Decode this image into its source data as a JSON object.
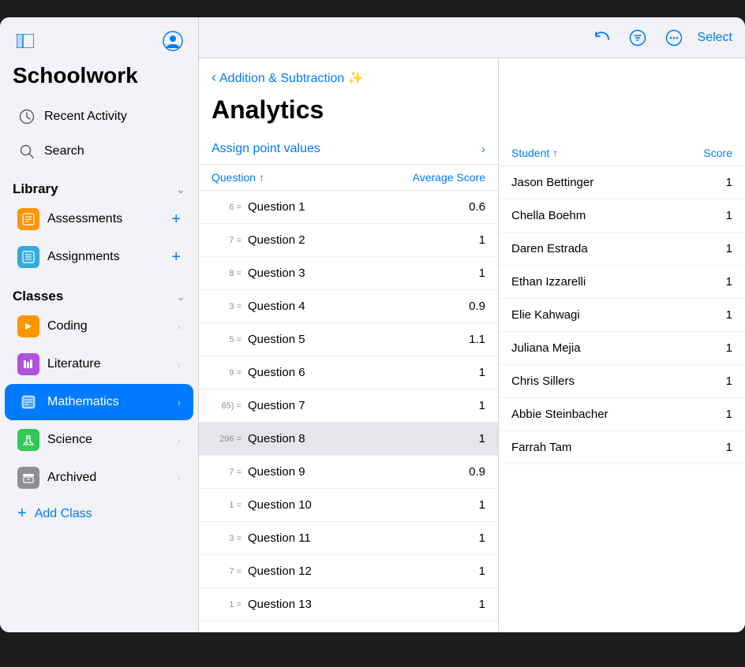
{
  "app": {
    "title": "Schoolwork"
  },
  "sidebar": {
    "recent_activity": "Recent Activity",
    "search": "Search",
    "library_section": "Library",
    "library_items": [
      {
        "id": "assessments",
        "label": "Assessments",
        "icon": "⊞",
        "type": "assessments"
      },
      {
        "id": "assignments",
        "label": "Assignments",
        "icon": "☰",
        "type": "assignments"
      }
    ],
    "classes_section": "Classes",
    "classes": [
      {
        "id": "coding",
        "label": "Coding",
        "icon": "🔶",
        "type": "coding",
        "selected": false
      },
      {
        "id": "literature",
        "label": "Literature",
        "icon": "📊",
        "type": "literature",
        "selected": false
      },
      {
        "id": "mathematics",
        "label": "Mathematics",
        "icon": "🗒️",
        "type": "mathematics",
        "selected": true
      },
      {
        "id": "science",
        "label": "Science",
        "icon": "✳️",
        "type": "science",
        "selected": false
      },
      {
        "id": "archived",
        "label": "Archived",
        "icon": "🗄️",
        "type": "archived",
        "selected": false
      }
    ],
    "add_class": "Add Class"
  },
  "nav": {
    "back_label": "Addition & Subtraction ✨"
  },
  "analytics": {
    "title": "Analytics",
    "assign_point_values": "Assign point values",
    "questions_header": "Question",
    "avg_score_header": "Average Score",
    "questions": [
      {
        "prefix": "6 =",
        "name": "Question 1",
        "score": "0.6"
      },
      {
        "prefix": "7 =",
        "name": "Question 2",
        "score": "1"
      },
      {
        "prefix": "8 =",
        "name": "Question 3",
        "score": "1"
      },
      {
        "prefix": "3 =",
        "name": "Question 4",
        "score": "0.9"
      },
      {
        "prefix": "5 =",
        "name": "Question 5",
        "score": "1.1"
      },
      {
        "prefix": "9 =",
        "name": "Question 6",
        "score": "1"
      },
      {
        "prefix": "",
        "name": "Question 7",
        "score": "1"
      },
      {
        "prefix": "296 =",
        "name": "Question 8",
        "score": "1",
        "selected": true
      },
      {
        "prefix": "7 =",
        "name": "Question 9",
        "score": "0.9"
      },
      {
        "prefix": "1 =",
        "name": "Question 10",
        "score": "1"
      },
      {
        "prefix": "3 =",
        "name": "Question 11",
        "score": "1"
      },
      {
        "prefix": "7 =",
        "name": "Question 12",
        "score": "1"
      },
      {
        "prefix": "1 =",
        "name": "Question 13",
        "score": "1"
      }
    ]
  },
  "students": {
    "header": "Student",
    "score_header": "Score",
    "list": [
      {
        "name": "Jason Bettinger",
        "score": "1"
      },
      {
        "name": "Chella Boehm",
        "score": "1"
      },
      {
        "name": "Daren Estrada",
        "score": "1"
      },
      {
        "name": "Ethan Izzarelli",
        "score": "1"
      },
      {
        "name": "Elie Kahwagi",
        "score": "1"
      },
      {
        "name": "Juliana Mejia",
        "score": "1"
      },
      {
        "name": "Chris Sillers",
        "score": "1"
      },
      {
        "name": "Abbie Steinbacher",
        "score": "1"
      },
      {
        "name": "Farrah Tam",
        "score": "1"
      }
    ]
  },
  "toolbar": {
    "select_label": "Select"
  },
  "icons": {
    "sidebar_toggle": "⊞",
    "profile": "👤",
    "chevron_down": "⌄",
    "chevron_right": "›",
    "chevron_left": "‹",
    "sort_asc": "↑",
    "undo": "↩",
    "filter": "☰",
    "more": "•••"
  }
}
